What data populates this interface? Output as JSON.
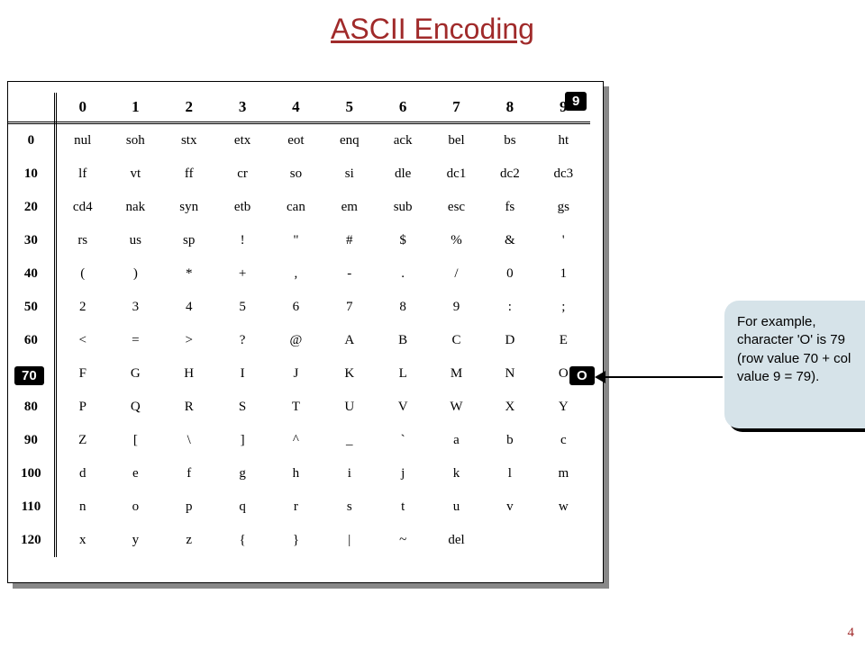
{
  "title": "ASCII Encoding",
  "page_number": "4",
  "highlight_col": "9",
  "highlight_row": "70",
  "highlight_cell": "O",
  "callout_text": "For example, character 'O' is 79 (row value 70 + col value 9 = 79).",
  "col_headers": [
    "0",
    "1",
    "2",
    "3",
    "4",
    "5",
    "6",
    "7",
    "8",
    "9"
  ],
  "row_headers": [
    "0",
    "10",
    "20",
    "30",
    "40",
    "50",
    "60",
    "70",
    "80",
    "90",
    "100",
    "110",
    "120"
  ],
  "rows": [
    [
      "nul",
      "soh",
      "stx",
      "etx",
      "eot",
      "enq",
      "ack",
      "bel",
      "bs",
      "ht"
    ],
    [
      "lf",
      "vt",
      "ff",
      "cr",
      "so",
      "si",
      "dle",
      "dc1",
      "dc2",
      "dc3"
    ],
    [
      "cd4",
      "nak",
      "syn",
      "etb",
      "can",
      "em",
      "sub",
      "esc",
      "fs",
      "gs"
    ],
    [
      "rs",
      "us",
      "sp",
      "!",
      "\"",
      "#",
      "$",
      "%",
      "&",
      "'"
    ],
    [
      "(",
      ")",
      "*",
      "+",
      ",",
      "-",
      ".",
      "/",
      "0",
      "1"
    ],
    [
      "2",
      "3",
      "4",
      "5",
      "6",
      "7",
      "8",
      "9",
      ":",
      ";"
    ],
    [
      "<",
      "=",
      ">",
      "?",
      "@",
      "A",
      "B",
      "C",
      "D",
      "E"
    ],
    [
      "F",
      "G",
      "H",
      "I",
      "J",
      "K",
      "L",
      "M",
      "N",
      "O"
    ],
    [
      "P",
      "Q",
      "R",
      "S",
      "T",
      "U",
      "V",
      "W",
      "X",
      "Y"
    ],
    [
      "Z",
      "[",
      "\\",
      "]",
      "^",
      "_",
      "`",
      "a",
      "b",
      "c"
    ],
    [
      "d",
      "e",
      "f",
      "g",
      "h",
      "i",
      "j",
      "k",
      "l",
      "m"
    ],
    [
      "n",
      "o",
      "p",
      "q",
      "r",
      "s",
      "t",
      "u",
      "v",
      "w"
    ],
    [
      "x",
      "y",
      "z",
      "{",
      "}",
      "|",
      "~",
      "del",
      "",
      ""
    ]
  ]
}
